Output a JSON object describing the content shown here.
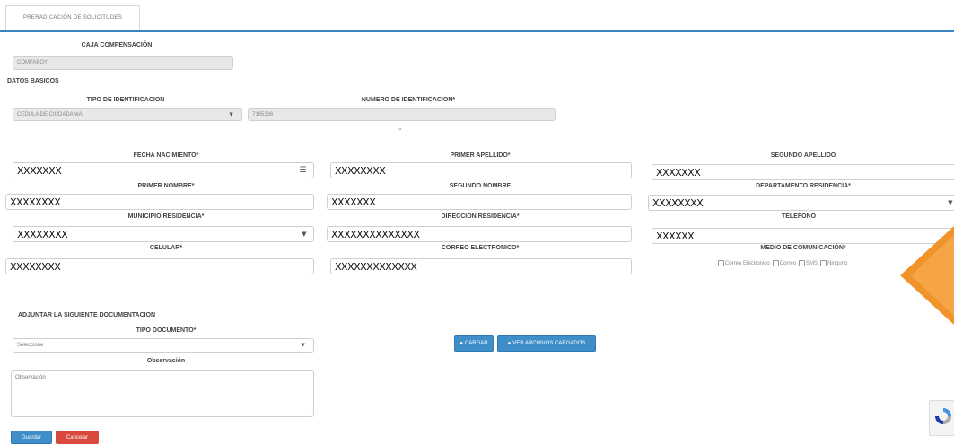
{
  "tab": {
    "label": "PRERADICACIÓN DE SOLICITUDES"
  },
  "caja": {
    "label": "CAJA COMPENSACIÓN",
    "value": "COMFABOY"
  },
  "datos_basicos": {
    "title": "DATOS BASICOS"
  },
  "tipo_identificacion": {
    "label": "TIPO DE IDENTIFICACION",
    "value": "CEDULA DE CIUDADANIA"
  },
  "numero_identificacion": {
    "label": "NUMERO DE IDENTIFICACION*",
    "value": "7165336"
  },
  "fecha_nacimiento": {
    "label": "FECHA NACIMIENTO*",
    "value": "XXXXXXX"
  },
  "primer_apellido": {
    "label": "PRIMER APELLIDO*",
    "value": "XXXXXXXX"
  },
  "segundo_apellido": {
    "label": "SEGUNDO APELLIDO",
    "value": "XXXXXXX"
  },
  "primer_nombre": {
    "label": "PRIMER NOMBRE*",
    "value": "XXXXXXXX"
  },
  "segundo_nombre": {
    "label": "SEGUNDO NOMBRE",
    "value": "XXXXXXX"
  },
  "departamento": {
    "label": "DEPARTAMENTO RESIDENCIA*",
    "value": "XXXXXXXX"
  },
  "municipio": {
    "label": "MUNICIPIO RESIDENCIA*",
    "value": "XXXXXXXX"
  },
  "direccion": {
    "label": "DIRECCION RESIDENCIA*",
    "value": "XXXXXXXXXXXXXX"
  },
  "telefono": {
    "label": "TELEFONO",
    "value": "XXXXXX"
  },
  "celular": {
    "label": "CELULAR*",
    "value": "XXXXXXXX"
  },
  "correo": {
    "label": "CORREO ELECTRONICO*",
    "value": "XXXXXXXXXXXXX"
  },
  "medio": {
    "label": "MEDIO DE COMUNICACIÓN*",
    "options": [
      "Correo Electronico",
      "Correo",
      "SMS",
      "Ninguno"
    ]
  },
  "adjuntar": {
    "title": "ADJUNTAR LA SIGUIENTE DOCUMENTACION"
  },
  "tipo_documento": {
    "label": "TIPO DOCUMENTO*",
    "value": "Seleccione"
  },
  "observacion": {
    "label": "Observación",
    "placeholder": "Observación"
  },
  "buttons": {
    "cargar": "CARGAR",
    "ver_archivos": "VER ARCHIVOS CARGADOS",
    "guardar": "Guardar",
    "cancelar": "Cancelar"
  },
  "colors": {
    "accent": "#3a83c4",
    "arrow": "#f0932b",
    "cancel": "#d9493d",
    "save": "#3d8ec9"
  }
}
